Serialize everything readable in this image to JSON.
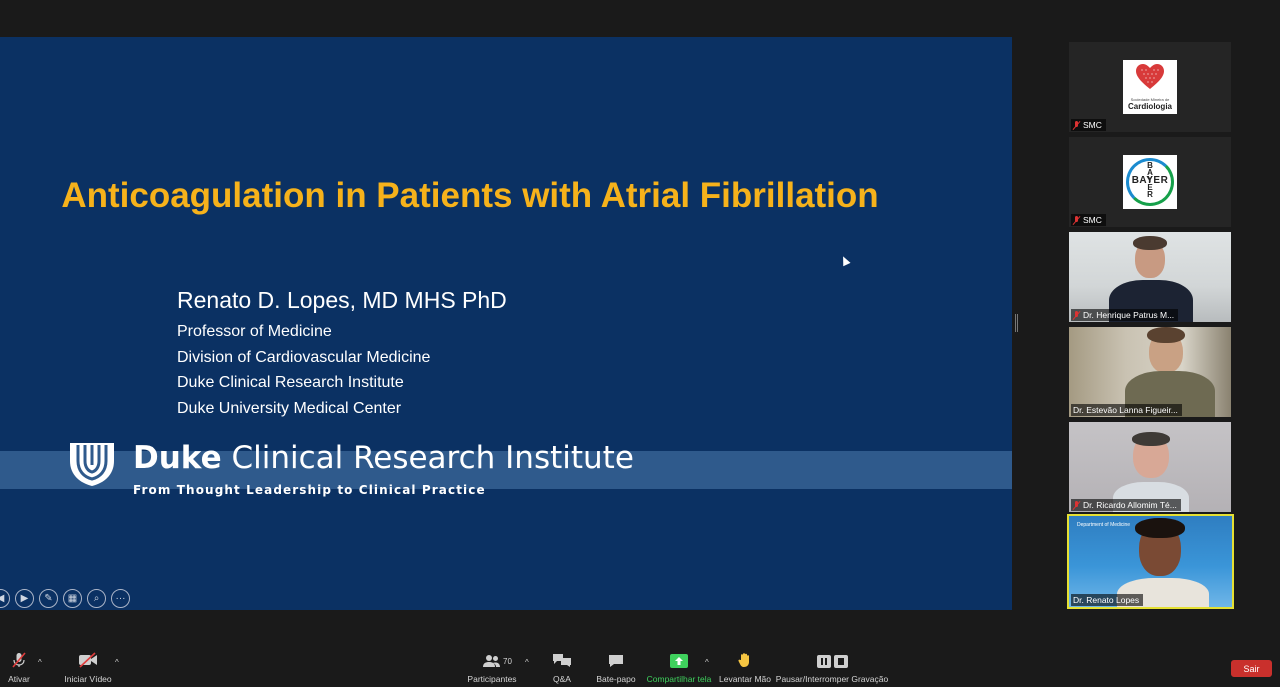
{
  "slide": {
    "title": "Anticoagulation in Patients with Atrial Fibrillation",
    "presenter": "Renato D. Lopes, MD MHS PhD",
    "lines": [
      "Professor of Medicine",
      "Division of Cardiovascular Medicine",
      "Duke Clinical Research Institute",
      "Duke University Medical Center"
    ],
    "brand_bold": "Duke",
    "brand_rest": " Clinical Research Institute",
    "tagline": "From Thought Leadership to Clinical Practice",
    "controls": [
      "prev-icon",
      "next-icon",
      "pen-icon",
      "slides-icon",
      "zoom-icon",
      "more-icon"
    ]
  },
  "participants": [
    {
      "name": "SMC",
      "muted": true,
      "logo": "smc",
      "logo_small": "Sociedade Mineira de",
      "logo_big": "Cardiologia"
    },
    {
      "name": "SMC",
      "muted": true,
      "logo": "bayer",
      "logo_text": "BAYER"
    },
    {
      "name": "Dr. Henrique Patrus M...",
      "muted": true
    },
    {
      "name": "Dr. Estevão Lanna Figueir...",
      "muted": false
    },
    {
      "name": "Dr. Ricardo Allomim Té...",
      "muted": true
    },
    {
      "name": "Dr. Renato Lopes",
      "muted": false,
      "active": true,
      "dept": "Department of Medicine"
    }
  ],
  "toolbar": {
    "mute": "Ativar",
    "video": "Iniciar Vídeo",
    "participants": "Participantes",
    "participant_count": "70",
    "qa": "Q&A",
    "chat": "Bate-papo",
    "share": "Compartilhar tela",
    "raise_hand": "Levantar Mão",
    "record": "Pausar/Interromper Gravação",
    "leave": "Sair"
  },
  "colors": {
    "slide_bg": "#0b3163",
    "title": "#f6b21b",
    "share_green": "#3fd15d",
    "leave_red": "#c9302c",
    "active_border": "#e5e033"
  }
}
